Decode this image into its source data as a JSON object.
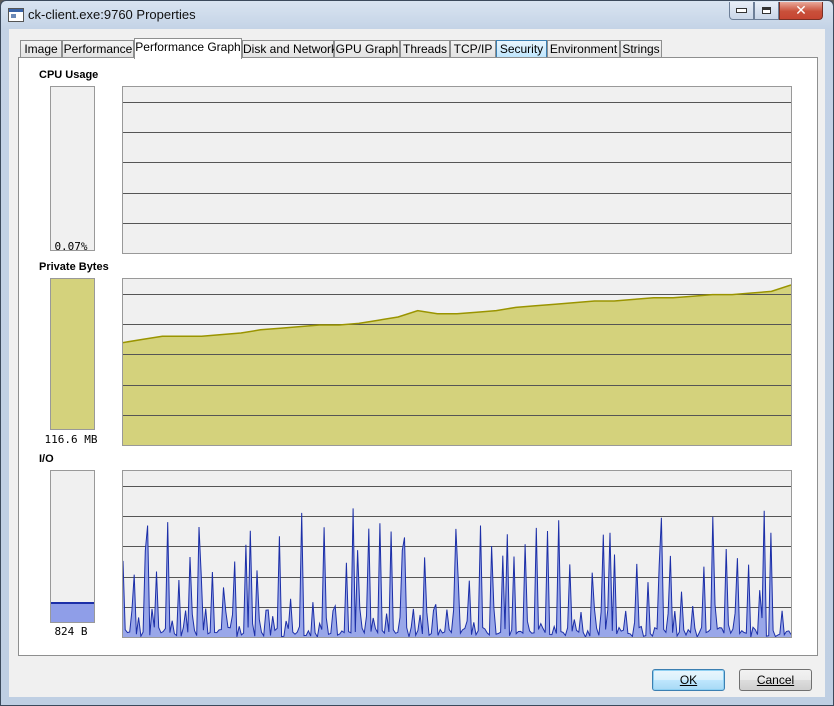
{
  "window": {
    "title": "ck-client.exe:9760 Properties",
    "icon": "window-app-icon"
  },
  "tabs": [
    {
      "label": "Image",
      "active": false
    },
    {
      "label": "Performance",
      "active": false
    },
    {
      "label": "Performance Graph",
      "active": true
    },
    {
      "label": "Disk and Network",
      "active": false
    },
    {
      "label": "GPU Graph",
      "active": false
    },
    {
      "label": "Threads",
      "active": false
    },
    {
      "label": "TCP/IP",
      "active": false
    },
    {
      "label": "Security",
      "active": false,
      "hover": true
    },
    {
      "label": "Environment",
      "active": false
    },
    {
      "label": "Strings",
      "active": false
    }
  ],
  "sections": {
    "cpu": {
      "label": "CPU Usage",
      "value": "0.07%",
      "meter_fraction": 0.0007,
      "history": [
        0,
        0,
        0,
        0,
        0,
        0,
        0,
        0,
        0,
        0
      ]
    },
    "private_bytes": {
      "label": "Private Bytes",
      "value": "116.6 MB",
      "meter_fraction": 1.0,
      "fill_color": "#d4d27c",
      "line_color": "#9a9400",
      "history": [
        0.64,
        0.66,
        0.68,
        0.68,
        0.68,
        0.69,
        0.7,
        0.72,
        0.73,
        0.74,
        0.75,
        0.75,
        0.76,
        0.78,
        0.8,
        0.84,
        0.82,
        0.82,
        0.83,
        0.84,
        0.86,
        0.87,
        0.88,
        0.89,
        0.9,
        0.9,
        0.91,
        0.92,
        0.92,
        0.93,
        0.94,
        0.94,
        0.95,
        0.96,
        1.0
      ]
    },
    "io": {
      "label": "I/O",
      "value": "824 B",
      "meter_fraction": 0.12,
      "fill_color": "#8f9ee8",
      "line_color": "#1c2fa8"
    }
  },
  "buttons": {
    "ok": "OK",
    "cancel": "Cancel"
  },
  "colors": {
    "graph_background": "#f0f0f0",
    "grid_line": "#555555",
    "accent": "#3c7fb1"
  }
}
